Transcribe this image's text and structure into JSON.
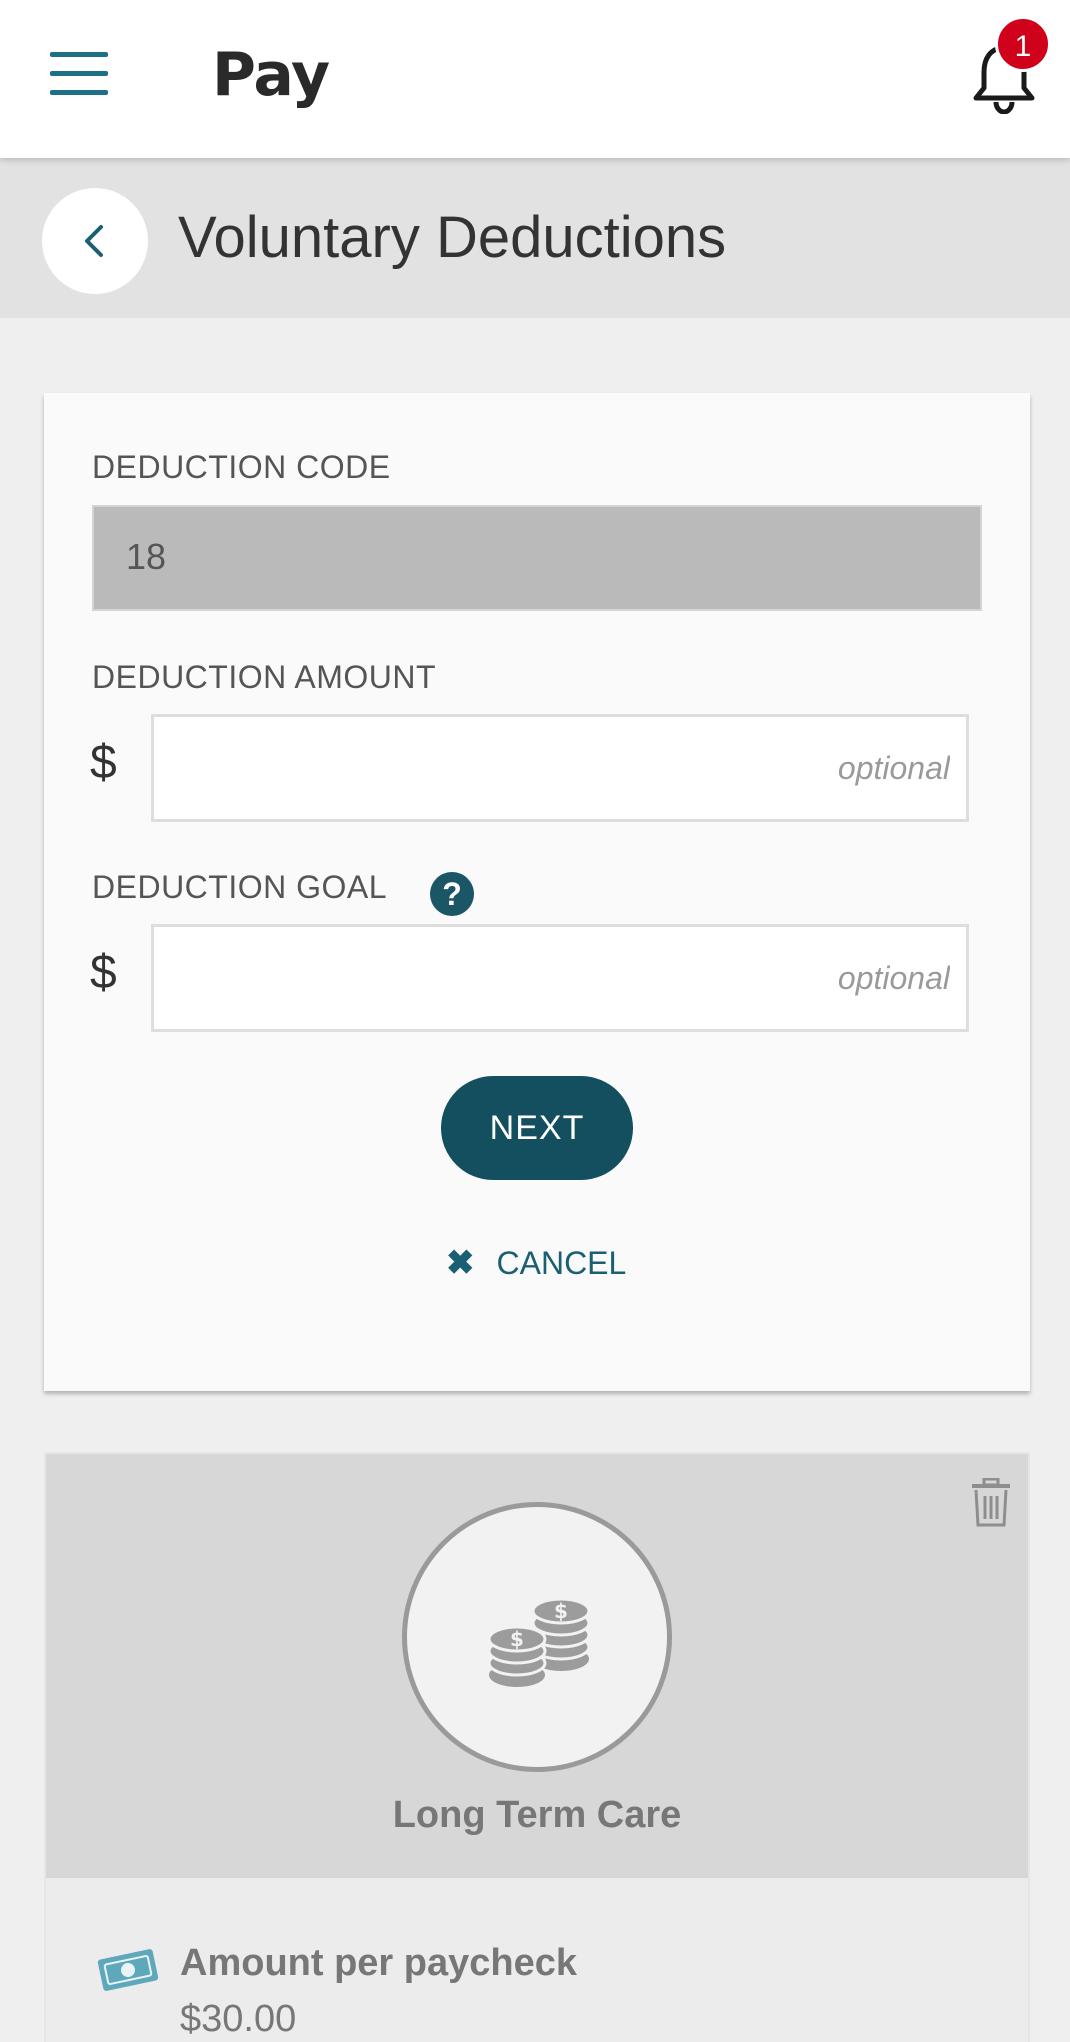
{
  "header": {
    "title": "Pay",
    "notification_count": "1",
    "menu_icon": "hamburger-menu-icon",
    "bell_icon": "bell-icon"
  },
  "subheader": {
    "title": "Voluntary Deductions",
    "back_icon": "chevron-left-icon"
  },
  "form": {
    "code_label": "DEDUCTION CODE",
    "code_value": "18",
    "amount_label": "DEDUCTION AMOUNT",
    "amount_currency": "$",
    "amount_placeholder": "optional",
    "goal_label": "DEDUCTION GOAL",
    "goal_help": "?",
    "goal_currency": "$",
    "goal_placeholder": "optional",
    "next_label": "NEXT",
    "cancel_label": "CANCEL",
    "cancel_icon": "close-icon"
  },
  "deduction": {
    "name": "Long Term Care",
    "per_paycheck_label": "Amount per paycheck",
    "per_paycheck_value": "$30.00",
    "icon": "coin-stack-icon",
    "delete_icon": "trash-icon"
  },
  "colors": {
    "accent": "#134f5f",
    "link": "#1b5f73",
    "badge": "#d0021b"
  }
}
